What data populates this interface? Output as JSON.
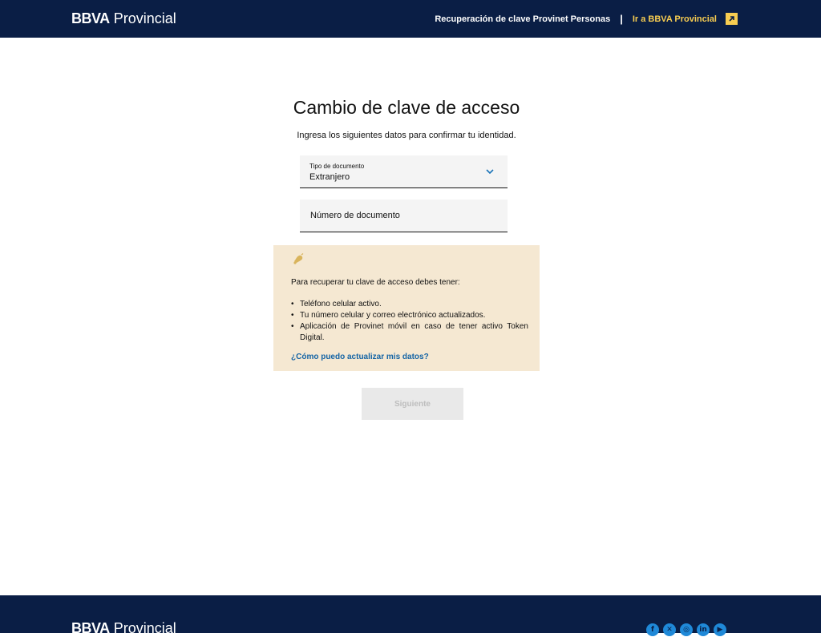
{
  "header": {
    "brand_bold": "BBVA",
    "brand_light": "Provincial",
    "recovery_link": "Recuperación de clave Provinet Personas",
    "separator": "|",
    "goto_link": "Ir a BBVA Provincial",
    "goto_icon": "external-arrow-icon",
    "accent_color": "#f8cd51",
    "bar_color": "#0a1e45"
  },
  "main": {
    "title": "Cambio de clave de acceso",
    "subtitle": "Ingresa los siguientes datos para confirmar tu identidad.",
    "doc_type": {
      "label": "Tipo de documento",
      "value": "Extranjero",
      "icon": "chevron-down-icon"
    },
    "doc_number": {
      "placeholder": "Número de documento",
      "value": ""
    },
    "info": {
      "icon": "bell-icon",
      "heading": "Para recuperar tu clave de acceso debes tener:",
      "items": [
        "Teléfono celular activo.",
        "Tu número celular y correo electrónico actualizados.",
        "Aplicación de Provinet móvil en caso de tener activo Token Digital."
      ],
      "link": "¿Cómo puedo actualizar mis datos?"
    },
    "next_button": "Siguiente"
  },
  "footer": {
    "brand_bold": "BBVA",
    "brand_light": "Provincial",
    "social_icons": [
      "facebook-icon",
      "x-icon",
      "instagram-icon",
      "linkedin-icon",
      "youtube-icon"
    ]
  }
}
